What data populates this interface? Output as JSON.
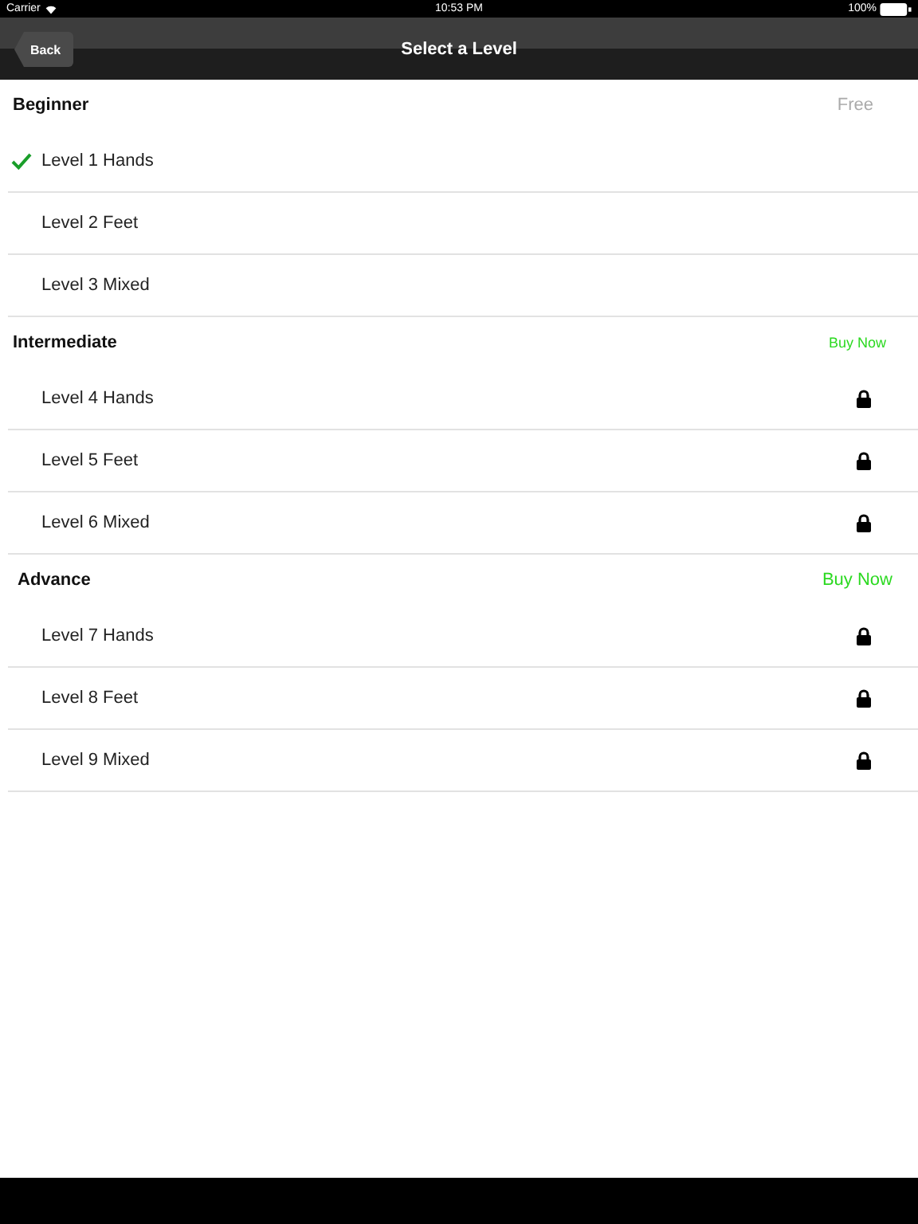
{
  "status_bar": {
    "carrier": "Carrier",
    "time": "10:53 PM",
    "battery": "100%"
  },
  "nav": {
    "back": "Back",
    "title": "Select a Level"
  },
  "sections": [
    {
      "title": "Beginner",
      "action": {
        "kind": "price",
        "label": "Free"
      },
      "rows": [
        {
          "label": "Level 1 Hands",
          "checked": true,
          "locked": false
        },
        {
          "label": "Level 2 Feet",
          "checked": false,
          "locked": false
        },
        {
          "label": "Level 3 Mixed",
          "checked": false,
          "locked": false
        }
      ]
    },
    {
      "title": "Intermediate",
      "action": {
        "kind": "buy",
        "label": "Buy Now"
      },
      "rows": [
        {
          "label": "Level 4 Hands",
          "checked": false,
          "locked": true
        },
        {
          "label": "Level 5 Feet",
          "checked": false,
          "locked": true
        },
        {
          "label": "Level 6 Mixed",
          "checked": false,
          "locked": true
        }
      ]
    },
    {
      "title": "Advance",
      "action": {
        "kind": "buy",
        "label": "Buy Now"
      },
      "rows": [
        {
          "label": "Level 7 Hands",
          "checked": false,
          "locked": true
        },
        {
          "label": "Level 8 Feet",
          "checked": false,
          "locked": true
        },
        {
          "label": "Level 9 Mixed",
          "checked": false,
          "locked": true
        }
      ]
    }
  ]
}
